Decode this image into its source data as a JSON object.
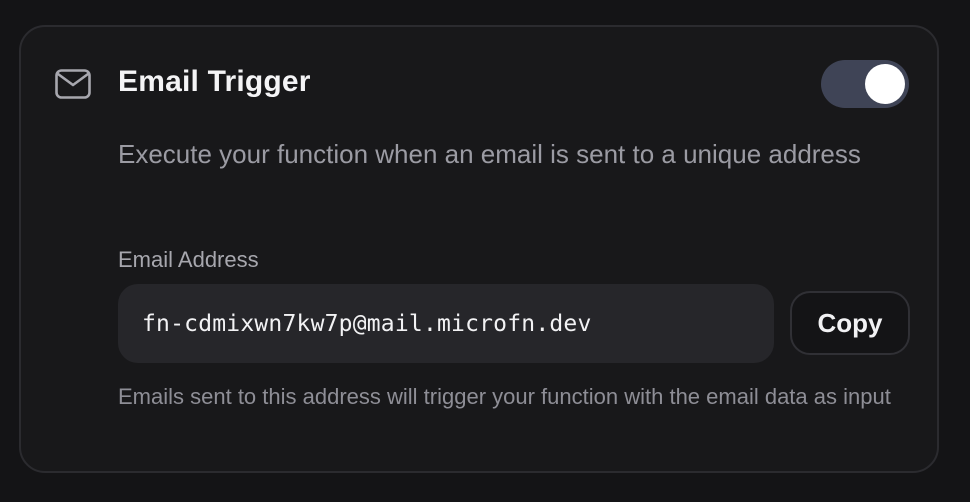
{
  "theme": {
    "accent": "#3f4456"
  },
  "trigger": {
    "icon": "mail-icon",
    "title": "Email Trigger",
    "enabled": true,
    "description": "Execute your function when an email is sent to a unique address"
  },
  "email_field": {
    "label": "Email Address",
    "value": "fn-cdmixwn7kw7p@mail.microfn.dev",
    "copy_label": "Copy",
    "help_text": "Emails sent to this address will trigger your function with the email data as input"
  }
}
